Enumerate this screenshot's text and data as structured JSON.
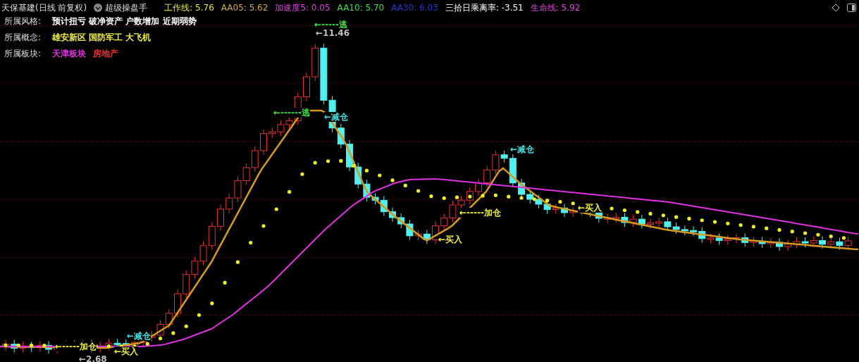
{
  "header": {
    "title": "天保基建(日线 前复权)",
    "indicator_name": "超级操盘手",
    "readings": [
      {
        "label": "工作线: 5.76",
        "color": "#e8e840"
      },
      {
        "label": "AA05: 5.62",
        "color": "#d8a848"
      },
      {
        "label": "加速度5: 0.05",
        "color": "#e040e0"
      },
      {
        "label": "AA10: 5.70",
        "color": "#40e040"
      },
      {
        "label": "AA30: 6.03",
        "color": "#2038c8"
      },
      {
        "label": "三拾日乘离率: -3.51",
        "color": "#ffffff"
      },
      {
        "label": "生命线: 5.92",
        "color": "#e040e0"
      }
    ]
  },
  "info": [
    {
      "label": "所属风格:",
      "tags": [
        {
          "text": "预计扭亏 破净资产 户数增加 近期弱势",
          "color": "#ffffff"
        }
      ]
    },
    {
      "label": "所属概念:",
      "tags": [
        {
          "text": "雄安新区 国防军工 大飞机",
          "color": "#f0f040"
        }
      ]
    },
    {
      "label": "所属板块:",
      "tags": [
        {
          "text": "天津板块",
          "color": "#e030e0"
        },
        {
          "text": "房地产",
          "color": "#f03030"
        }
      ]
    }
  ],
  "annotations": [
    {
      "text": "←-----逃",
      "color": "#40e040"
    },
    {
      "text": "←11.46",
      "color": "#c0c0c0"
    },
    {
      "text": "←------逃",
      "color": "#40e040"
    },
    {
      "text": "←减仓",
      "color": "#40e0e0"
    },
    {
      "text": "←减仓",
      "color": "#40e0e0"
    },
    {
      "text": "←-----加仓",
      "color": "#f0f040"
    },
    {
      "text": "←买入",
      "color": "#f0f040"
    },
    {
      "text": "←买入",
      "color": "#f0f040"
    },
    {
      "text": "←减仓",
      "color": "#40e0e0"
    },
    {
      "text": "←-----加仓",
      "color": "#f0f040"
    },
    {
      "text": "←2.68",
      "color": "#c0c0c0"
    },
    {
      "text": "←买入",
      "color": "#f0f040"
    }
  ]
}
